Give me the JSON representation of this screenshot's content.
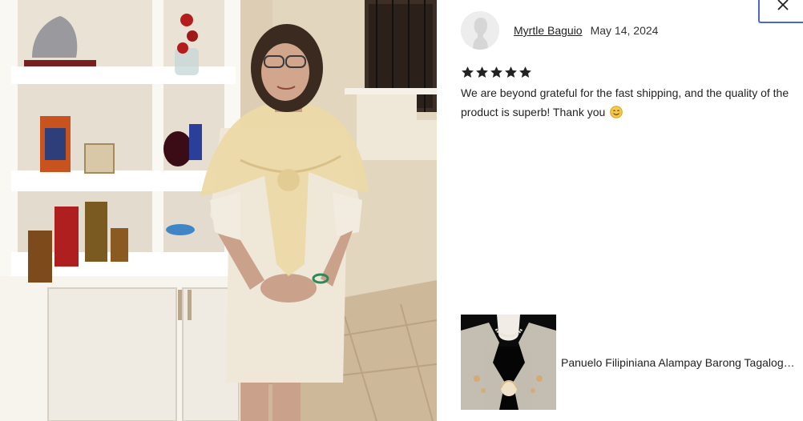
{
  "review": {
    "reviewer_name": "Myrtle Baguio",
    "date": "May 14, 2024",
    "rating": 5,
    "rating_max": 5,
    "text": "We are beyond grateful for the fast shipping, and the quality of the product is superb! Thank you",
    "emoji_icon": "smiling-face-emoji"
  },
  "product": {
    "name": "Panuelo Filipiniana Alampay Barong Tagalog Shawl"
  },
  "icons": {
    "close": "close-icon",
    "avatar": "default-avatar-icon",
    "star": "star-icon"
  },
  "colors": {
    "close_border": "#4a67c9",
    "star": "#222222",
    "text": "#222222"
  }
}
